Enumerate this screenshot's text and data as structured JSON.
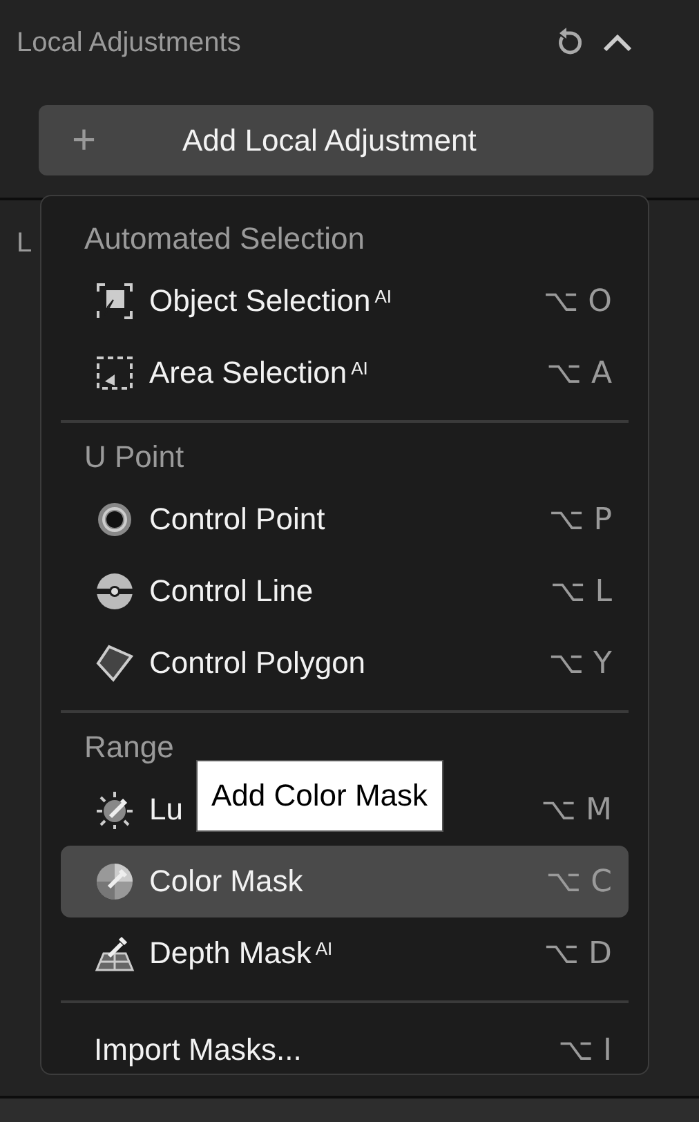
{
  "panel": {
    "title": "Local Adjustments"
  },
  "add_button": {
    "icon": "+",
    "label": "Add Local Adjustment"
  },
  "background_label": "L",
  "menu": {
    "sections": [
      {
        "header": "Automated Selection",
        "items": [
          {
            "label": "Object Selection",
            "badge": "AI",
            "shortcut": "⌥ O",
            "selected": false
          },
          {
            "label": "Area Selection",
            "badge": "AI",
            "shortcut": "⌥ A",
            "selected": false
          }
        ]
      },
      {
        "header": "U Point",
        "items": [
          {
            "label": "Control Point",
            "shortcut": "⌥ P",
            "selected": false
          },
          {
            "label": "Control Line",
            "shortcut": "⌥ L",
            "selected": false
          },
          {
            "label": "Control Polygon",
            "shortcut": "⌥ Y",
            "selected": false
          }
        ]
      },
      {
        "header": "Range",
        "items": [
          {
            "label": "Lu",
            "shortcut": "⌥ M",
            "selected": false
          },
          {
            "label": "Color Mask",
            "shortcut": "⌥ C",
            "selected": true
          },
          {
            "label": "Depth Mask",
            "badge": "AI",
            "shortcut": "⌥ D",
            "selected": false
          }
        ]
      },
      {
        "items": [
          {
            "label": "Import Masks...",
            "shortcut": "⌥ I",
            "selected": false
          }
        ]
      }
    ]
  },
  "tooltip": {
    "text": "Add Color Mask"
  }
}
